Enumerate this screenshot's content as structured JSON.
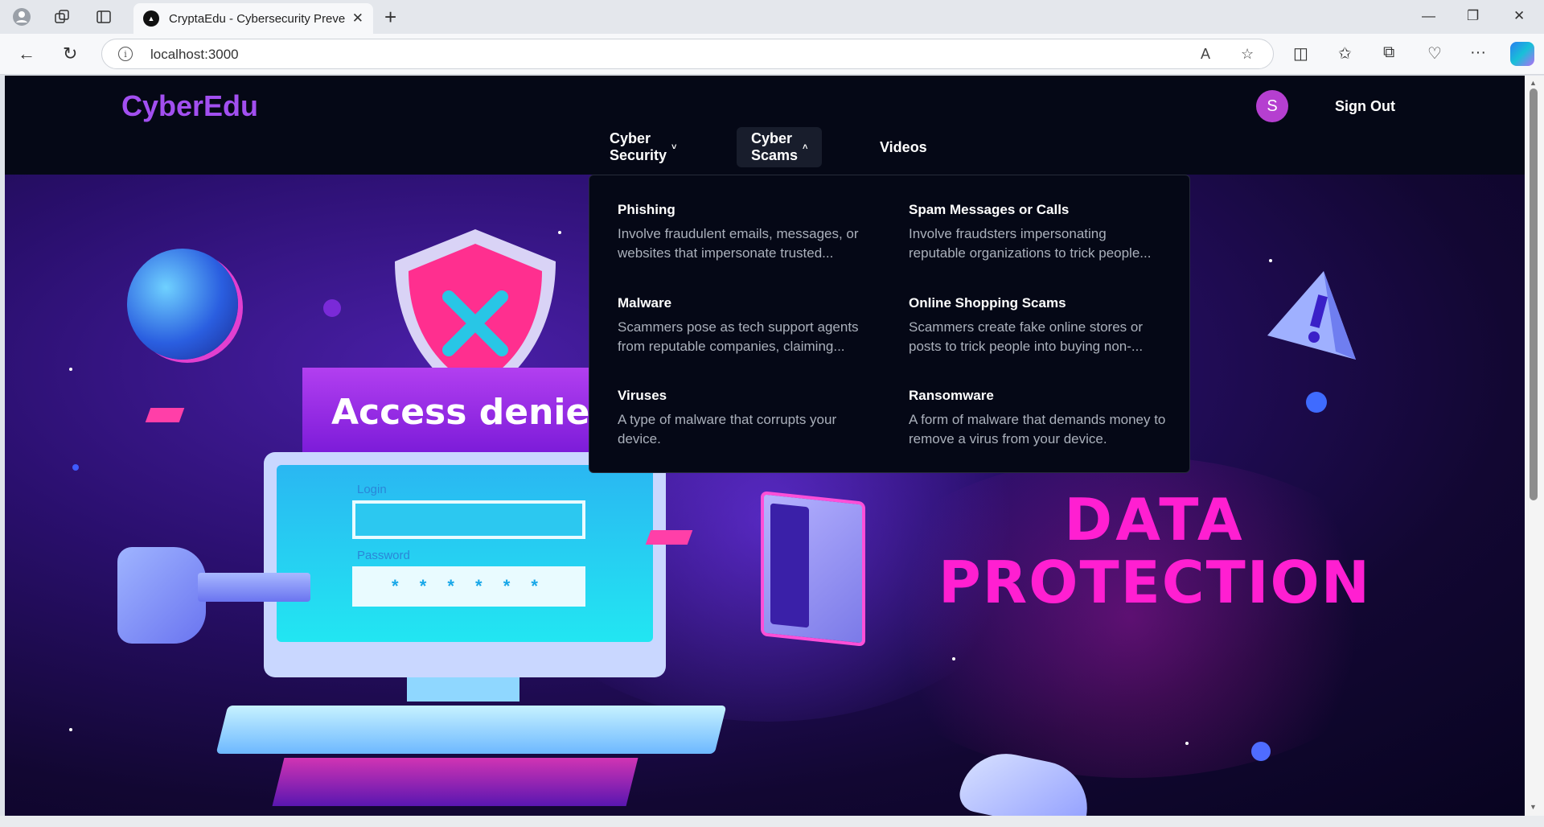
{
  "browser": {
    "tab_title": "CryptaEdu - Cybersecurity Preven",
    "url": "localhost:3000"
  },
  "site": {
    "logo": "CyberEdu",
    "avatar_initial": "S",
    "sign_out": "Sign Out",
    "nav": [
      {
        "label": "Cyber Security",
        "chevron": "˅"
      },
      {
        "label": "Cyber Scams",
        "chevron": "˄"
      },
      {
        "label": "Videos"
      }
    ],
    "dropdown": [
      {
        "title": "Phishing",
        "desc": "Involve fraudulent emails, messages, or websites that impersonate trusted..."
      },
      {
        "title": "Spam Messages or Calls",
        "desc": "Involve fraudsters impersonating reputable organizations to trick people..."
      },
      {
        "title": "Malware",
        "desc": "Scammers pose as tech support agents from reputable companies, claiming..."
      },
      {
        "title": "Online Shopping Scams",
        "desc": "Scammers create fake online stores or posts to trick people into buying non-..."
      },
      {
        "title": "Viruses",
        "desc": "A type of malware that corrupts your device."
      },
      {
        "title": "Ransomware",
        "desc": "A form of malware that demands money to remove a virus from your device."
      }
    ]
  },
  "hero": {
    "access_text": "Access denie",
    "login_label": "Login",
    "password_label": "Password",
    "password_mask": "* * * * * *",
    "title_line1": "DATA",
    "title_line2": "PROTECTION"
  },
  "colors": {
    "accent": "#a24ff0",
    "hero_title": "#ff1fd1"
  }
}
